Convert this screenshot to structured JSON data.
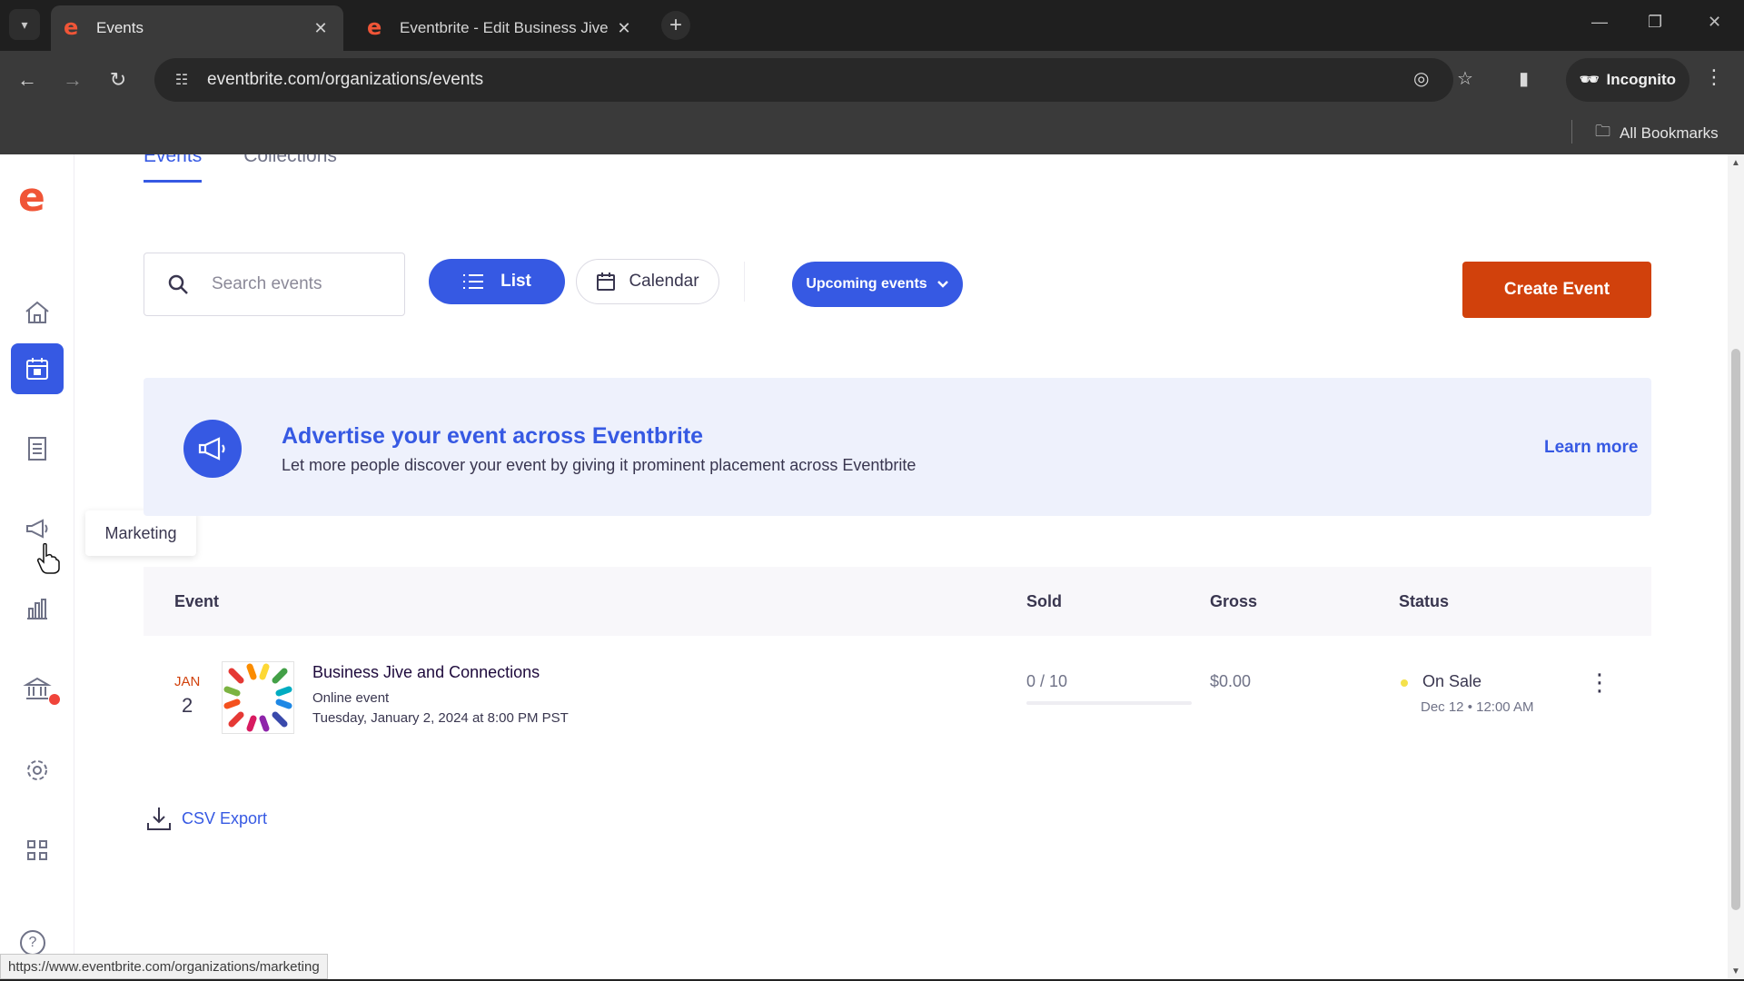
{
  "browser": {
    "tabs": [
      {
        "title": "Events",
        "active": true,
        "favicon": "eventbrite-icon"
      },
      {
        "title": "Eventbrite - Edit Business Jive",
        "active": false,
        "favicon": "eventbrite-icon"
      }
    ],
    "url": "eventbrite.com/organizations/events",
    "incognito_label": "Incognito",
    "bookmarks_label": "All Bookmarks",
    "status_url": "https://www.eventbrite.com/organizations/marketing"
  },
  "sidebar": {
    "logo": "e",
    "items": [
      {
        "name": "home",
        "icon": "home-icon"
      },
      {
        "name": "events",
        "icon": "calendar-icon",
        "active": true
      },
      {
        "name": "orders",
        "icon": "receipt-icon"
      },
      {
        "name": "marketing",
        "icon": "megaphone-icon"
      },
      {
        "name": "reports",
        "icon": "bar-chart-icon"
      },
      {
        "name": "finance",
        "icon": "bank-icon"
      },
      {
        "name": "settings",
        "icon": "gear-icon"
      },
      {
        "name": "apps",
        "icon": "grid-icon"
      },
      {
        "name": "help",
        "icon": "help-icon"
      }
    ],
    "tooltip": "Marketing"
  },
  "main": {
    "tabs": [
      {
        "label": "Events",
        "active": true
      },
      {
        "label": "Collections",
        "active": false
      }
    ],
    "search_placeholder": "Search events",
    "view_list_label": "List",
    "view_calendar_label": "Calendar",
    "filter_label": "Upcoming events",
    "create_label": "Create Event",
    "banner": {
      "title": "Advertise your event across Eventbrite",
      "subtitle": "Let more people discover your event by giving it prominent placement across Eventbrite",
      "link": "Learn more"
    },
    "table": {
      "columns": [
        "Event",
        "Sold",
        "Gross",
        "Status"
      ],
      "rows": [
        {
          "month": "JAN",
          "day": "2",
          "title": "Business Jive and Connections",
          "type": "Online event",
          "datetime": "Tuesday, January 2, 2024 at 8:00 PM PST",
          "sold": "0 / 10",
          "sold_fraction": 0,
          "gross": "$0.00",
          "status": "On Sale",
          "status_date": "Dec 12 • 12:00 AM"
        }
      ]
    },
    "csv_label": "CSV Export"
  },
  "colors": {
    "brand": "#f05537",
    "primary": "#3659e3",
    "create": "#d1410c"
  }
}
